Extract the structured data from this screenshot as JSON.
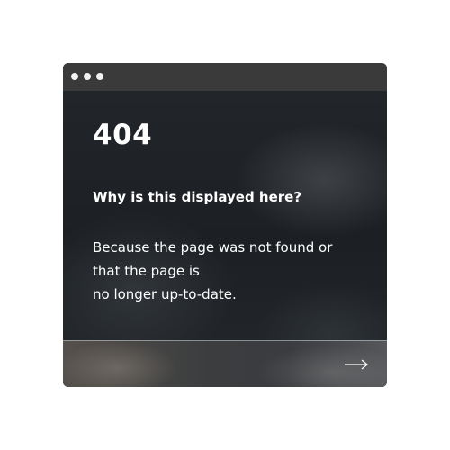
{
  "window": {
    "controls": [
      "dot-icon",
      "dot-icon",
      "dot-icon"
    ]
  },
  "content": {
    "code": "404",
    "question": "Why is this displayed here?",
    "answer_lines": [
      "Because the page was not found or",
      "that the page is",
      "no longer up-to-date."
    ]
  },
  "footer": {
    "next_icon": "arrow-right-icon"
  },
  "colors": {
    "page_background": "#ffffff",
    "window_background": "#1f2327",
    "titlebar": "#3a3a3a",
    "text": "#ffffff"
  }
}
